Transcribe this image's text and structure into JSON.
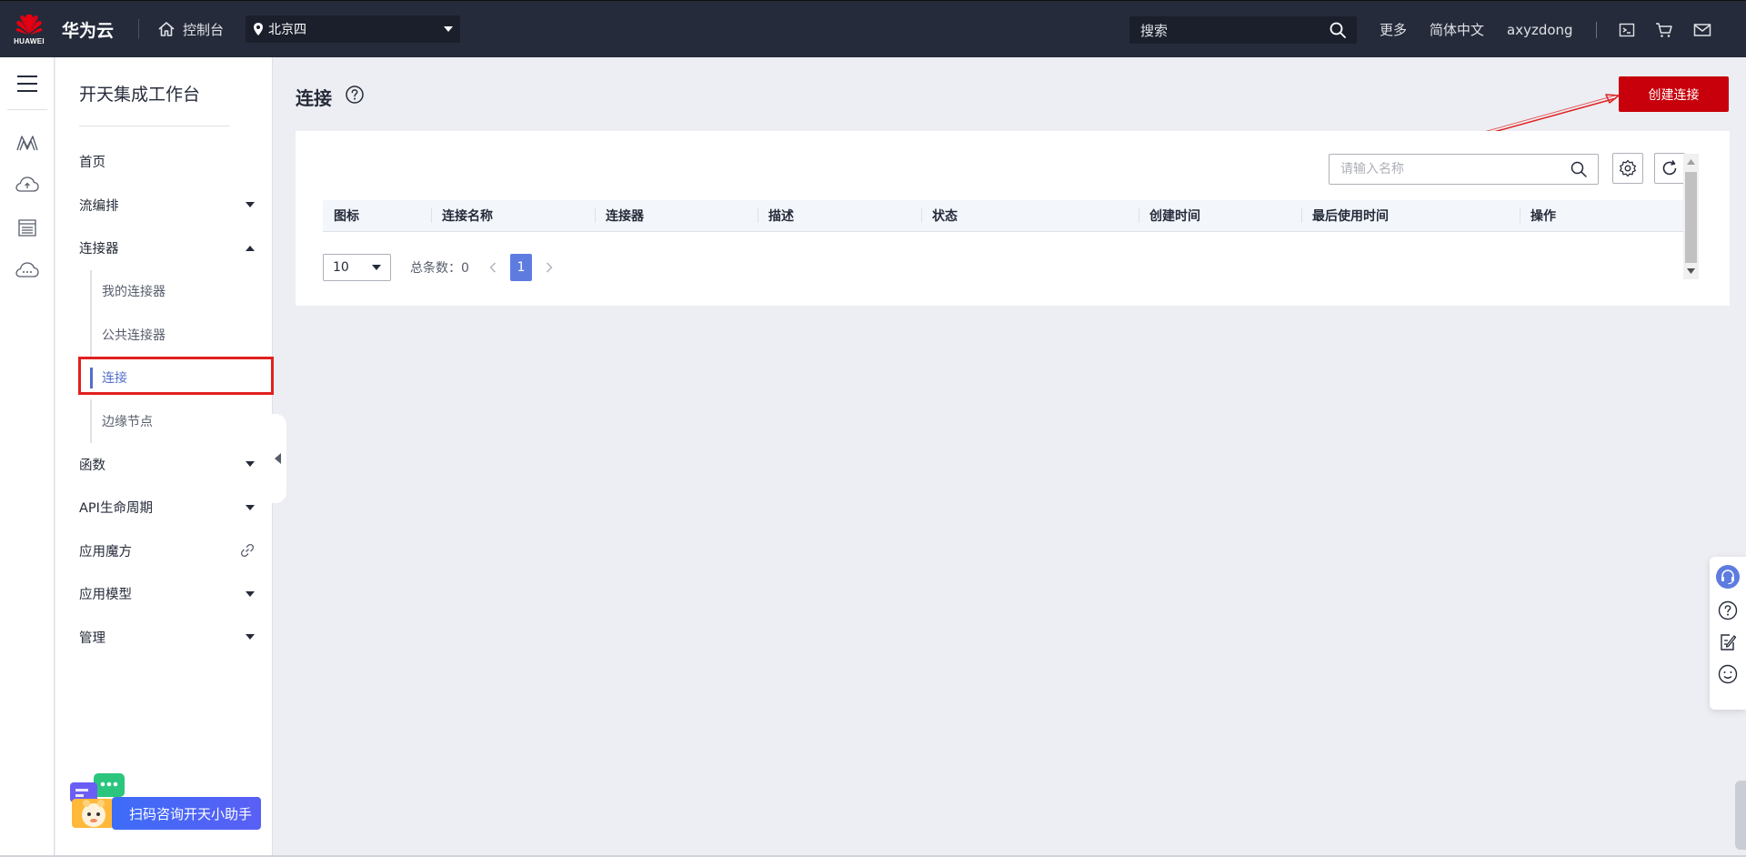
{
  "topbar": {
    "logo_text": "HUAWEI",
    "brand": "华为云",
    "console": "控制台",
    "region": "北京四",
    "search_placeholder": "搜索",
    "more": "更多",
    "language": "简体中文",
    "username": "axyzdong"
  },
  "sidebar": {
    "title": "开天集成工作台",
    "items": [
      {
        "label": "首页"
      },
      {
        "label": "流编排"
      },
      {
        "label": "连接器"
      },
      {
        "label": "我的连接器"
      },
      {
        "label": "公共连接器"
      },
      {
        "label": "连接"
      },
      {
        "label": "边缘节点"
      },
      {
        "label": "函数"
      },
      {
        "label": "API生命周期"
      },
      {
        "label": "应用魔方"
      },
      {
        "label": "应用模型"
      },
      {
        "label": "管理"
      }
    ],
    "qr_banner": "扫码咨询开天小助手"
  },
  "main": {
    "title": "连接",
    "create_button": "创建连接",
    "search_placeholder": "请输入名称",
    "columns": [
      "图标",
      "连接名称",
      "连接器",
      "描述",
      "状态",
      "创建时间",
      "最后使用时间",
      "操作"
    ],
    "page_size": "10",
    "total_label": "总条数：0",
    "current_page": "1"
  },
  "colors": {
    "topbar_bg": "#252b3a",
    "primary_red": "#c7000b",
    "active_blue": "#526ecc",
    "page_blue": "#5e7ce0"
  }
}
